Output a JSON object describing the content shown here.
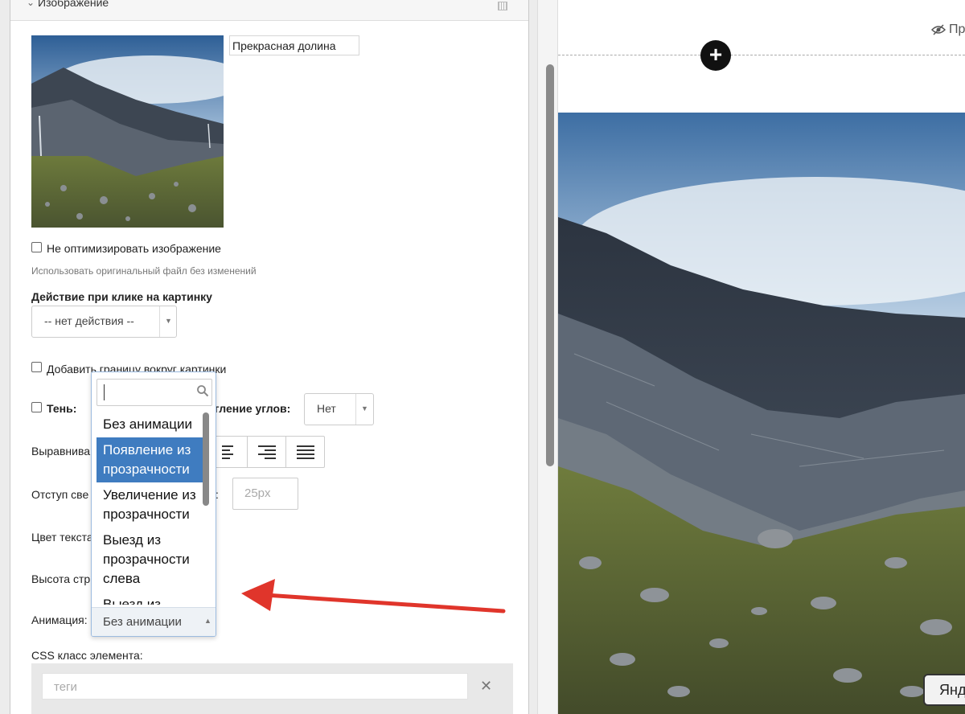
{
  "panel": {
    "section_title": "Изображение",
    "image_title_value": "Прекрасная долина",
    "no_optimize_label": "Не оптимизировать изображение",
    "no_optimize_hint": "Использовать оригинальный файл без изменений",
    "click_action_label": "Действие при клике на картинку",
    "click_action_value": "-- нет действия --",
    "add_border_label": "Добавить границу вокруг картинки",
    "shadow_label": "Тень:",
    "rounding_label": "угление углов:",
    "rounding_value": "Нет",
    "align_label": "Выравнива",
    "indent_label": "Отступ све",
    "indent_colon": ":",
    "indent_value": "25px",
    "text_color_label": "Цвет текста",
    "line_height_label": "Высота стр",
    "animation_label": "Анимация:",
    "css_class_label": "CSS класс элемента:",
    "tags_placeholder": "теги"
  },
  "dropdown": {
    "search_value": "",
    "options": [
      "Без анимации",
      "Появление из прозрачности",
      "Увеличение из прозрачности",
      "Выезд из прозрачности слева",
      "Выезд из"
    ],
    "active_index": 1,
    "selected_value": "Без анимации"
  },
  "preview": {
    "link_text": "Пр",
    "add_symbol": "+",
    "button_text": "Янд"
  },
  "colors": {
    "accent": "#3f7cc0",
    "annotation_arrow": "#e0352b"
  }
}
